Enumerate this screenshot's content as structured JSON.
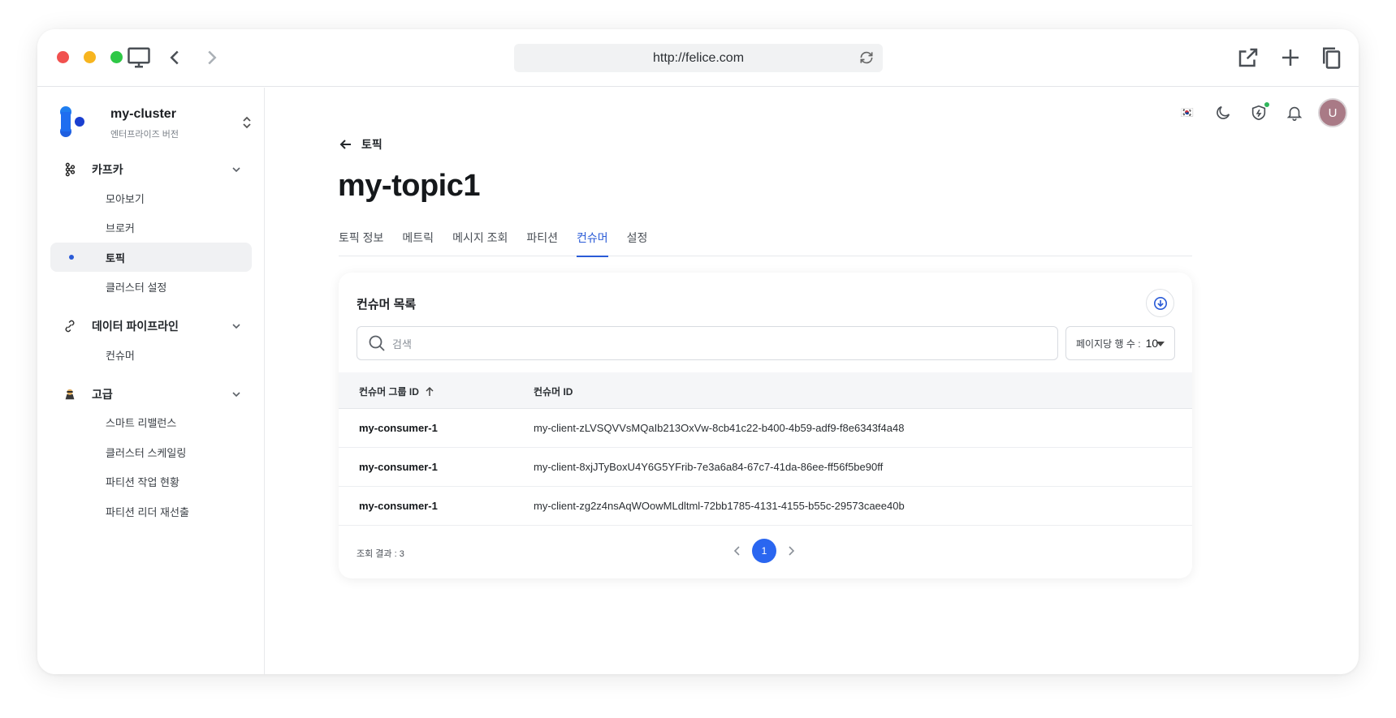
{
  "browser": {
    "url": "http://felice.com"
  },
  "sidebar": {
    "cluster_name": "my-cluster",
    "cluster_edition": "엔터프라이즈 버전",
    "groups": [
      {
        "label": "카프카",
        "items": [
          "모아보기",
          "브로커",
          "토픽",
          "클러스터 설정"
        ]
      },
      {
        "label": "데이터 파이프라인",
        "items": [
          "컨슈머"
        ]
      },
      {
        "label": "고급",
        "items": [
          "스마트 리밸런스",
          "클러스터 스케일링",
          "파티션 작업 현황",
          "파티션 리더 재선출"
        ]
      }
    ],
    "active_item": "토픽"
  },
  "header": {
    "language_flag": "🇰🇷",
    "avatar_initial": "U"
  },
  "main": {
    "back_label": "토픽",
    "page_title": "my-topic1",
    "tabs": [
      "토픽 정보",
      "메트릭",
      "메시지 조회",
      "파티션",
      "컨슈머",
      "설정"
    ],
    "active_tab": "컨슈머"
  },
  "card": {
    "title": "컨슈머 목록",
    "search_placeholder": "검색",
    "rows_per_page_label": "페이지당 행 수 :",
    "rows_per_page_value": "10",
    "columns": [
      "컨슈머 그룹 ID",
      "컨슈머 ID"
    ],
    "rows": [
      {
        "group_id": "my-consumer-1",
        "consumer_id": "my-client-zLVSQVVsMQaIb213OxVw-8cb41c22-b400-4b59-adf9-f8e6343f4a48"
      },
      {
        "group_id": "my-consumer-1",
        "consumer_id": "my-client-8xjJTyBoxU4Y6G5YFrib-7e3a6a84-67c7-41da-86ee-ff56f5be90ff"
      },
      {
        "group_id": "my-consumer-1",
        "consumer_id": "my-client-zg2z4nsAqWOowMLdltml-72bb1785-4131-4155-b55c-29573caee40b"
      }
    ],
    "result_label": "조회 결과 : 3",
    "current_page": "1"
  },
  "colors": {
    "accent": "#2a5bd7",
    "pager_active": "#2a66f0",
    "close": "#f1514f",
    "minimize": "#f7b51f",
    "maximize": "#2ec846"
  }
}
